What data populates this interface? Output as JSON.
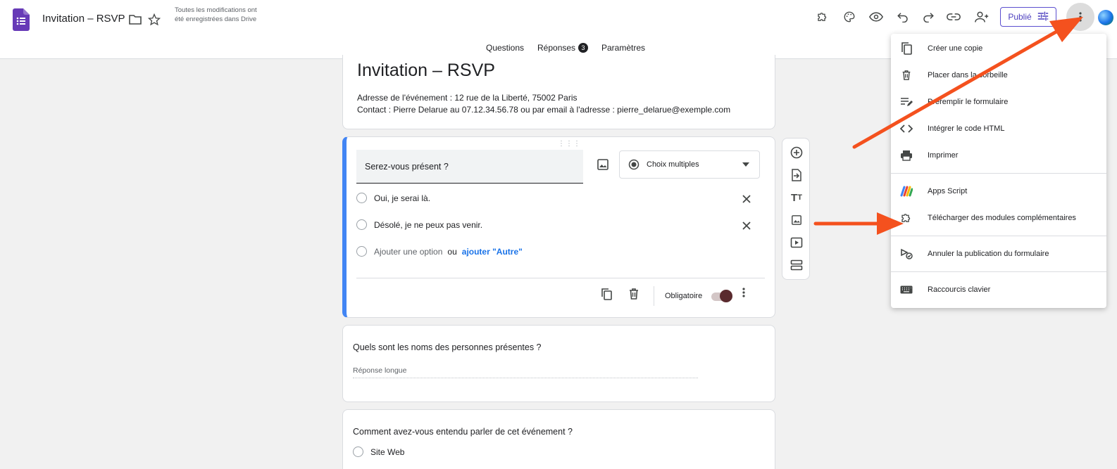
{
  "header": {
    "doc_title": "Invitation – RSVP",
    "save_status": "Toutes les modifications ont été enregistrées dans Drive",
    "publish_label": "Publié"
  },
  "tabs": {
    "questions": "Questions",
    "responses": "Réponses",
    "responses_count": "3",
    "settings": "Paramètres"
  },
  "form": {
    "title": "Invitation – RSVP",
    "description_line1": "Adresse de l'événement : 12 rue de la Liberté, 75002 Paris",
    "description_line2": "Contact : Pierre Delarue au 07.12.34.56.78 ou par email à l'adresse : pierre_delarue@exemple.com"
  },
  "question1": {
    "title": "Serez-vous présent ?",
    "type": "Choix multiples",
    "options": [
      "Oui, je serai là.",
      "Désolé, je ne peux pas venir."
    ],
    "add_option": "Ajouter une option",
    "or": "ou",
    "add_other": "ajouter \"Autre\"",
    "required_label": "Obligatoire"
  },
  "question2": {
    "title": "Quels sont les noms des personnes présentes ?",
    "answer_placeholder": "Réponse longue"
  },
  "question3": {
    "title": "Comment avez-vous entendu parler de cet événement ?",
    "options": [
      "Site Web"
    ]
  },
  "menu": {
    "items": [
      {
        "label": "Créer une copie",
        "icon": "copy-icon"
      },
      {
        "label": "Placer dans la corbeille",
        "icon": "trash-icon"
      },
      {
        "label": "Préremplir le formulaire",
        "icon": "prefill-icon"
      },
      {
        "label": "Intégrer le code HTML",
        "icon": "code-icon"
      },
      {
        "label": "Imprimer",
        "icon": "printer-icon"
      },
      {
        "label": "Apps Script",
        "icon": "apps-script-icon"
      },
      {
        "label": "Télécharger des modules complémentaires",
        "icon": "puzzle-icon"
      },
      {
        "label": "Annuler la publication du formulaire",
        "icon": "unpublish-icon"
      },
      {
        "label": "Raccourcis clavier",
        "icon": "keyboard-icon"
      }
    ]
  },
  "colors": {
    "accent": "#673ab7",
    "question_border": "#4285f4",
    "arrow": "#f4511e",
    "toggle_knob": "#5a2a2e"
  }
}
